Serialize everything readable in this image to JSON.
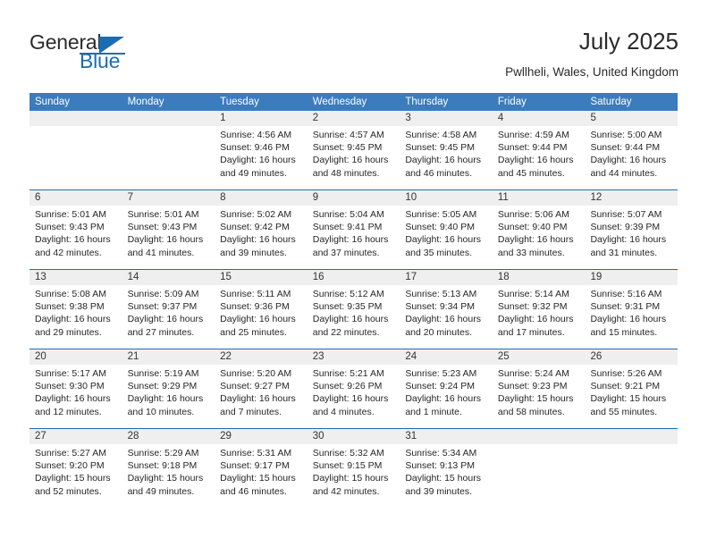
{
  "brand": {
    "name_part1": "General",
    "name_part2": "Blue",
    "logo_icon": "triangle-icon",
    "accent_color": "#1a6db5"
  },
  "header": {
    "title": "July 2025",
    "location": "Pwllheli, Wales, United Kingdom"
  },
  "calendar": {
    "header_color": "#3a7cbe",
    "separator_color": "#1f6cb0",
    "daynum_band_color": "#efefef",
    "weekdays": [
      "Sunday",
      "Monday",
      "Tuesday",
      "Wednesday",
      "Thursday",
      "Friday",
      "Saturday"
    ],
    "weeks": [
      {
        "numbers": [
          "",
          "",
          "1",
          "2",
          "3",
          "4",
          "5"
        ],
        "days": [
          {},
          {},
          {
            "sunrise": "Sunrise: 4:56 AM",
            "sunset": "Sunset: 9:46 PM",
            "daylight1": "Daylight: 16 hours",
            "daylight2": "and 49 minutes."
          },
          {
            "sunrise": "Sunrise: 4:57 AM",
            "sunset": "Sunset: 9:45 PM",
            "daylight1": "Daylight: 16 hours",
            "daylight2": "and 48 minutes."
          },
          {
            "sunrise": "Sunrise: 4:58 AM",
            "sunset": "Sunset: 9:45 PM",
            "daylight1": "Daylight: 16 hours",
            "daylight2": "and 46 minutes."
          },
          {
            "sunrise": "Sunrise: 4:59 AM",
            "sunset": "Sunset: 9:44 PM",
            "daylight1": "Daylight: 16 hours",
            "daylight2": "and 45 minutes."
          },
          {
            "sunrise": "Sunrise: 5:00 AM",
            "sunset": "Sunset: 9:44 PM",
            "daylight1": "Daylight: 16 hours",
            "daylight2": "and 44 minutes."
          }
        ]
      },
      {
        "numbers": [
          "6",
          "7",
          "8",
          "9",
          "10",
          "11",
          "12"
        ],
        "days": [
          {
            "sunrise": "Sunrise: 5:01 AM",
            "sunset": "Sunset: 9:43 PM",
            "daylight1": "Daylight: 16 hours",
            "daylight2": "and 42 minutes."
          },
          {
            "sunrise": "Sunrise: 5:01 AM",
            "sunset": "Sunset: 9:43 PM",
            "daylight1": "Daylight: 16 hours",
            "daylight2": "and 41 minutes."
          },
          {
            "sunrise": "Sunrise: 5:02 AM",
            "sunset": "Sunset: 9:42 PM",
            "daylight1": "Daylight: 16 hours",
            "daylight2": "and 39 minutes."
          },
          {
            "sunrise": "Sunrise: 5:04 AM",
            "sunset": "Sunset: 9:41 PM",
            "daylight1": "Daylight: 16 hours",
            "daylight2": "and 37 minutes."
          },
          {
            "sunrise": "Sunrise: 5:05 AM",
            "sunset": "Sunset: 9:40 PM",
            "daylight1": "Daylight: 16 hours",
            "daylight2": "and 35 minutes."
          },
          {
            "sunrise": "Sunrise: 5:06 AM",
            "sunset": "Sunset: 9:40 PM",
            "daylight1": "Daylight: 16 hours",
            "daylight2": "and 33 minutes."
          },
          {
            "sunrise": "Sunrise: 5:07 AM",
            "sunset": "Sunset: 9:39 PM",
            "daylight1": "Daylight: 16 hours",
            "daylight2": "and 31 minutes."
          }
        ]
      },
      {
        "numbers": [
          "13",
          "14",
          "15",
          "16",
          "17",
          "18",
          "19"
        ],
        "days": [
          {
            "sunrise": "Sunrise: 5:08 AM",
            "sunset": "Sunset: 9:38 PM",
            "daylight1": "Daylight: 16 hours",
            "daylight2": "and 29 minutes."
          },
          {
            "sunrise": "Sunrise: 5:09 AM",
            "sunset": "Sunset: 9:37 PM",
            "daylight1": "Daylight: 16 hours",
            "daylight2": "and 27 minutes."
          },
          {
            "sunrise": "Sunrise: 5:11 AM",
            "sunset": "Sunset: 9:36 PM",
            "daylight1": "Daylight: 16 hours",
            "daylight2": "and 25 minutes."
          },
          {
            "sunrise": "Sunrise: 5:12 AM",
            "sunset": "Sunset: 9:35 PM",
            "daylight1": "Daylight: 16 hours",
            "daylight2": "and 22 minutes."
          },
          {
            "sunrise": "Sunrise: 5:13 AM",
            "sunset": "Sunset: 9:34 PM",
            "daylight1": "Daylight: 16 hours",
            "daylight2": "and 20 minutes."
          },
          {
            "sunrise": "Sunrise: 5:14 AM",
            "sunset": "Sunset: 9:32 PM",
            "daylight1": "Daylight: 16 hours",
            "daylight2": "and 17 minutes."
          },
          {
            "sunrise": "Sunrise: 5:16 AM",
            "sunset": "Sunset: 9:31 PM",
            "daylight1": "Daylight: 16 hours",
            "daylight2": "and 15 minutes."
          }
        ]
      },
      {
        "numbers": [
          "20",
          "21",
          "22",
          "23",
          "24",
          "25",
          "26"
        ],
        "days": [
          {
            "sunrise": "Sunrise: 5:17 AM",
            "sunset": "Sunset: 9:30 PM",
            "daylight1": "Daylight: 16 hours",
            "daylight2": "and 12 minutes."
          },
          {
            "sunrise": "Sunrise: 5:19 AM",
            "sunset": "Sunset: 9:29 PM",
            "daylight1": "Daylight: 16 hours",
            "daylight2": "and 10 minutes."
          },
          {
            "sunrise": "Sunrise: 5:20 AM",
            "sunset": "Sunset: 9:27 PM",
            "daylight1": "Daylight: 16 hours",
            "daylight2": "and 7 minutes."
          },
          {
            "sunrise": "Sunrise: 5:21 AM",
            "sunset": "Sunset: 9:26 PM",
            "daylight1": "Daylight: 16 hours",
            "daylight2": "and 4 minutes."
          },
          {
            "sunrise": "Sunrise: 5:23 AM",
            "sunset": "Sunset: 9:24 PM",
            "daylight1": "Daylight: 16 hours",
            "daylight2": "and 1 minute."
          },
          {
            "sunrise": "Sunrise: 5:24 AM",
            "sunset": "Sunset: 9:23 PM",
            "daylight1": "Daylight: 15 hours",
            "daylight2": "and 58 minutes."
          },
          {
            "sunrise": "Sunrise: 5:26 AM",
            "sunset": "Sunset: 9:21 PM",
            "daylight1": "Daylight: 15 hours",
            "daylight2": "and 55 minutes."
          }
        ]
      },
      {
        "numbers": [
          "27",
          "28",
          "29",
          "30",
          "31",
          "",
          ""
        ],
        "days": [
          {
            "sunrise": "Sunrise: 5:27 AM",
            "sunset": "Sunset: 9:20 PM",
            "daylight1": "Daylight: 15 hours",
            "daylight2": "and 52 minutes."
          },
          {
            "sunrise": "Sunrise: 5:29 AM",
            "sunset": "Sunset: 9:18 PM",
            "daylight1": "Daylight: 15 hours",
            "daylight2": "and 49 minutes."
          },
          {
            "sunrise": "Sunrise: 5:31 AM",
            "sunset": "Sunset: 9:17 PM",
            "daylight1": "Daylight: 15 hours",
            "daylight2": "and 46 minutes."
          },
          {
            "sunrise": "Sunrise: 5:32 AM",
            "sunset": "Sunset: 9:15 PM",
            "daylight1": "Daylight: 15 hours",
            "daylight2": "and 42 minutes."
          },
          {
            "sunrise": "Sunrise: 5:34 AM",
            "sunset": "Sunset: 9:13 PM",
            "daylight1": "Daylight: 15 hours",
            "daylight2": "and 39 minutes."
          },
          {},
          {}
        ]
      }
    ]
  }
}
